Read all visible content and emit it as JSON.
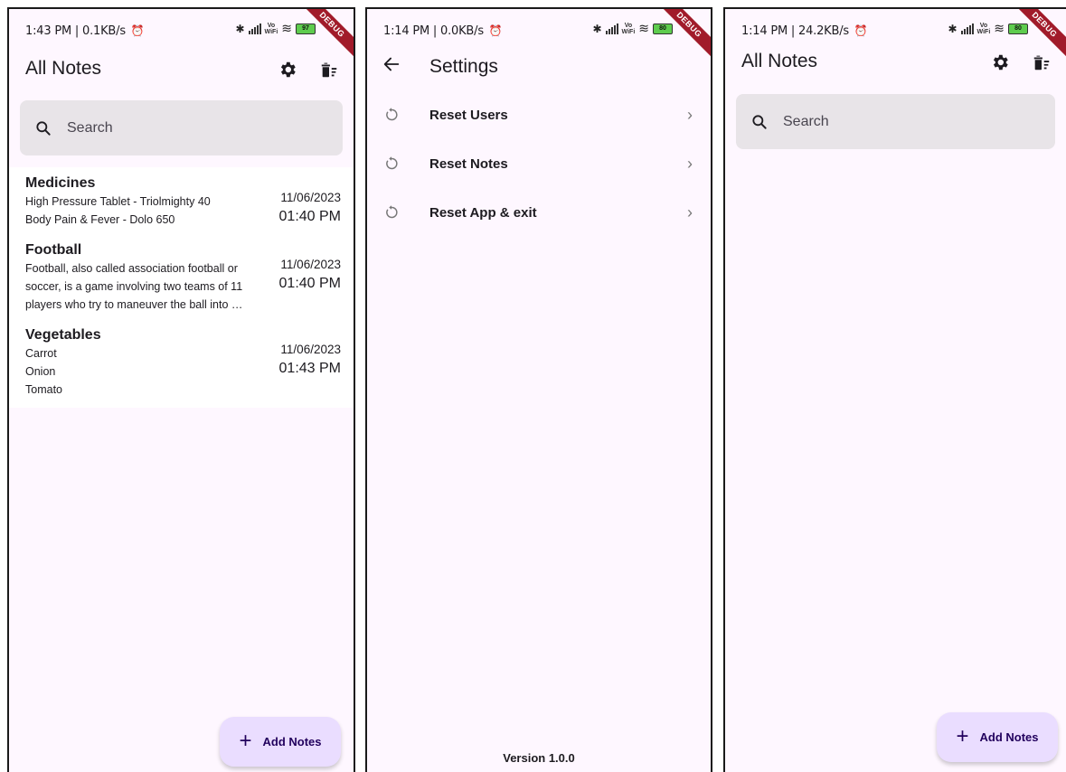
{
  "screen1": {
    "status_time": "1:43 PM | 0.1KB/s",
    "battery": "97",
    "debug": "DEBUG",
    "title": "All Notes",
    "search_placeholder": "Search",
    "notes": [
      {
        "title": "Medicines",
        "body": "High Pressure Tablet - Triolmighty 40\nBody Pain & Fever - Dolo 650",
        "date": "11/06/2023",
        "time": "01:40 PM"
      },
      {
        "title": "Football",
        "body": "Football, also called association football or soccer, is a game involving two teams of 11 players who try to maneuver the ball into …",
        "date": "11/06/2023",
        "time": "01:40 PM"
      },
      {
        "title": "Vegetables",
        "body": "Carrot\nOnion\nTomato",
        "date": "11/06/2023",
        "time": "01:43 PM"
      }
    ],
    "fab_label": "Add Notes"
  },
  "screen2": {
    "status_time": "1:14 PM | 0.0KB/s",
    "battery": "80",
    "debug": "DEBUG",
    "title": "Settings",
    "items": [
      {
        "label": "Reset Users"
      },
      {
        "label": "Reset Notes"
      },
      {
        "label": "Reset App & exit"
      }
    ],
    "version": "Version 1.0.0"
  },
  "screen3": {
    "status_time": "1:14 PM | 24.2KB/s",
    "battery": "80",
    "debug": "DEBUG",
    "title": "All Notes",
    "search_placeholder": "Search",
    "fab_label": "Add Notes"
  },
  "colors": {
    "background": "#fef7ff",
    "search_fill": "#e8e4e8",
    "fab_fill": "#eaddff",
    "fab_text": "#21005d",
    "debug_banner": "#a11b2a"
  },
  "icons": [
    "alarm-icon",
    "bluetooth-icon",
    "signal-icon",
    "wifi-icon",
    "battery-icon",
    "gear-icon",
    "delete-sweep-icon",
    "search-icon",
    "plus-icon",
    "back-arrow-icon",
    "reset-icon",
    "chevron-right-icon"
  ]
}
